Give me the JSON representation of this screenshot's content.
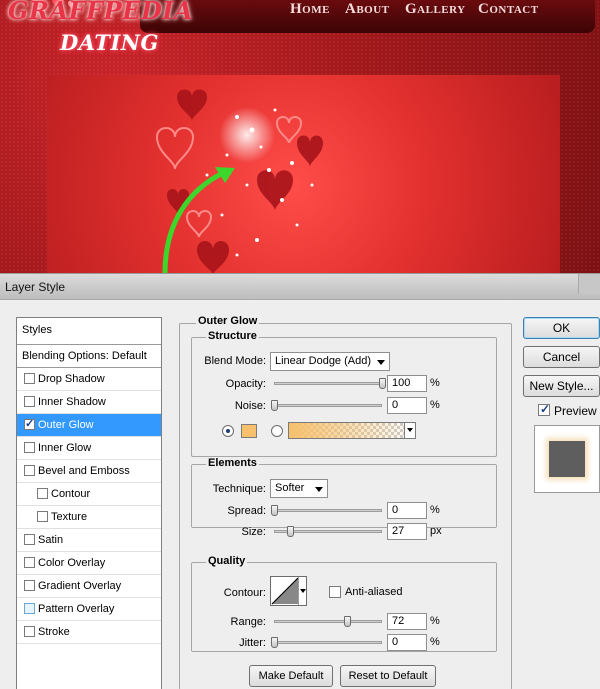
{
  "site": {
    "logo_top": "GRAFFPEDIA",
    "logo_bottom": "DATING",
    "nav": [
      "Home",
      "About",
      "Gallery",
      "Contact"
    ]
  },
  "dialog": {
    "title": "Layer Style",
    "styles_header": "Styles",
    "blending_options": "Blending Options: Default",
    "effects": [
      {
        "label": "Drop Shadow",
        "checked": false
      },
      {
        "label": "Inner Shadow",
        "checked": false
      },
      {
        "label": "Outer Glow",
        "checked": true,
        "active": true
      },
      {
        "label": "Inner Glow",
        "checked": false
      },
      {
        "label": "Bevel and Emboss",
        "checked": false
      },
      {
        "label": "Contour",
        "checked": false
      },
      {
        "label": "Texture",
        "checked": false
      },
      {
        "label": "Satin",
        "checked": false
      },
      {
        "label": "Color Overlay",
        "checked": false
      },
      {
        "label": "Gradient Overlay",
        "checked": false
      },
      {
        "label": "Pattern Overlay",
        "checked": false
      },
      {
        "label": "Stroke",
        "checked": false
      }
    ],
    "panel_title": "Outer Glow",
    "structure": {
      "title": "Structure",
      "blend_mode_label": "Blend Mode:",
      "blend_mode": "Linear Dodge (Add)",
      "opacity_label": "Opacity:",
      "opacity": "100",
      "noise_label": "Noise:",
      "noise": "0",
      "glow_color": "#f7c06c",
      "percent": "%"
    },
    "elements": {
      "title": "Elements",
      "technique_label": "Technique:",
      "technique": "Softer",
      "spread_label": "Spread:",
      "spread": "0",
      "size_label": "Size:",
      "size": "27",
      "percent": "%",
      "px": "px"
    },
    "quality": {
      "title": "Quality",
      "contour_label": "Contour:",
      "anti_aliased": "Anti-aliased",
      "range_label": "Range:",
      "range": "72",
      "jitter_label": "Jitter:",
      "jitter": "0",
      "percent": "%"
    },
    "buttons": {
      "ok": "OK",
      "cancel": "Cancel",
      "new_style": "New Style...",
      "preview": "Preview",
      "make_default": "Make Default",
      "reset_default": "Reset to Default"
    }
  }
}
